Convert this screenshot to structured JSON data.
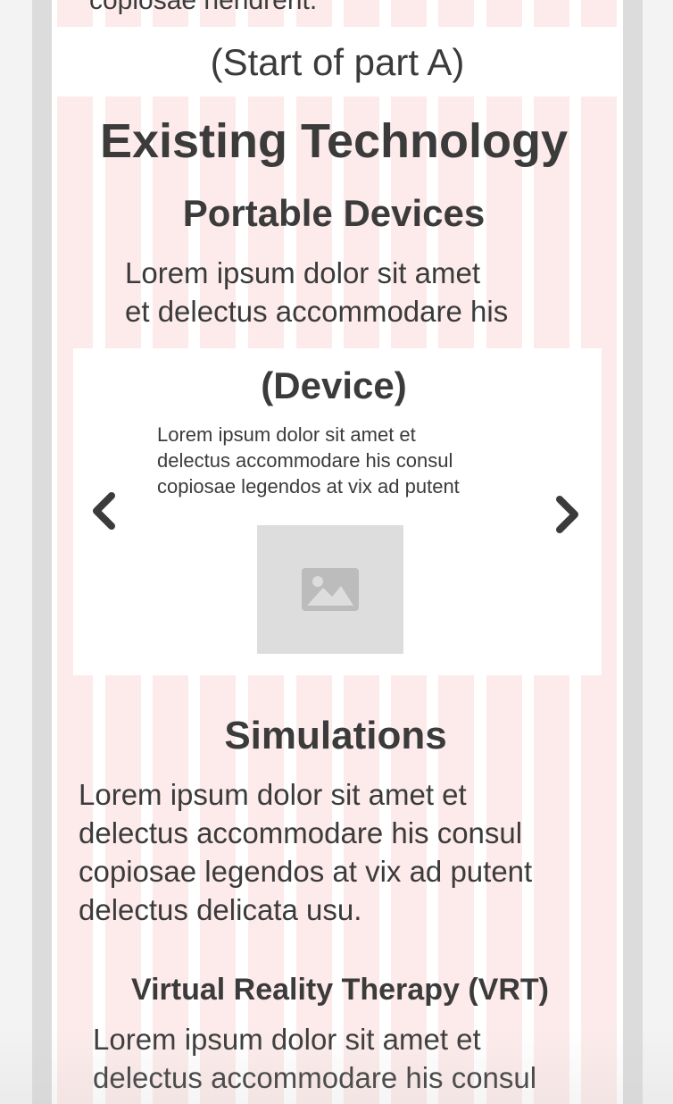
{
  "top_partial_text": "copiosae hendrerit.",
  "part_label": "(Start of part A)",
  "section_title": "Existing Technology",
  "portable_devices": {
    "heading": "Portable Devices",
    "line1": "Lorem ipsum dolor sit amet",
    "line2": "et delectus accommodare his"
  },
  "carousel": {
    "title": "(Device)",
    "line1": "Lorem ipsum dolor sit amet et",
    "line2": "delectus accommodare his consul",
    "line3": "copiosae legendos at vix ad putent",
    "prev_icon": "chevron-left-icon",
    "next_icon": "chevron-right-icon",
    "image_icon": "image-placeholder-icon"
  },
  "simulations": {
    "heading": "Simulations",
    "line1": "Lorem ipsum dolor sit amet et",
    "line2": "delectus accommodare his consul",
    "line3": "copiosae legendos at vix ad putent",
    "line4": "delectus delicata usu."
  },
  "vrt": {
    "heading": "Virtual Reality Therapy (VRT)",
    "line1": "Lorem ipsum dolor sit amet et",
    "line2": "delectus accommodare his consul"
  },
  "colors": {
    "text": "#3c3b3c",
    "stripe": "#fcebea",
    "frame": "#dcdcdc",
    "placeholder": "#dddddd"
  }
}
